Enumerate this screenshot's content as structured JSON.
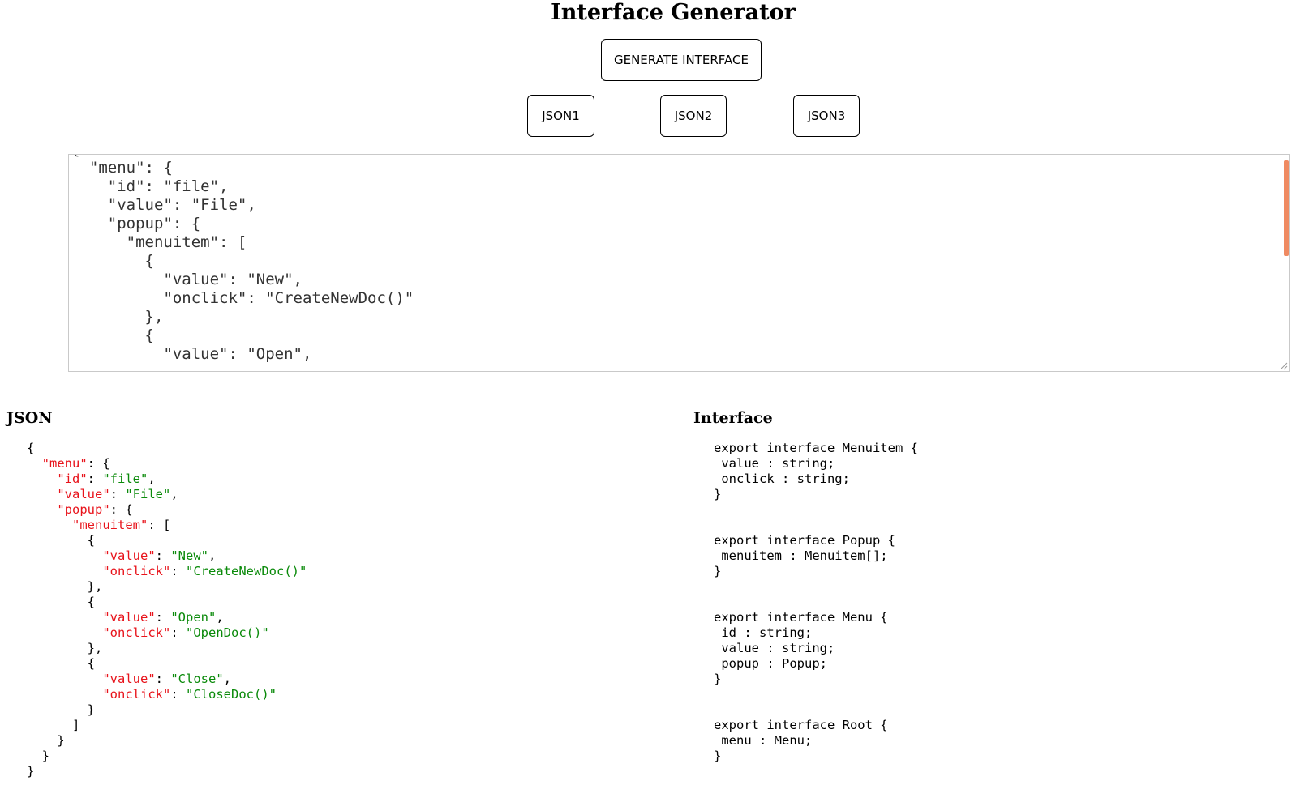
{
  "page": {
    "title": "Interface Generator"
  },
  "buttons": {
    "generate": "GENERATE INTERFACE",
    "json1": "JSON1",
    "json2": "JSON2",
    "json3": "JSON3"
  },
  "editor": {
    "visible_text": "{\n  \"menu\": {\n    \"id\": \"file\",\n    \"value\": \"File\",\n    \"popup\": {\n      \"menuitem\": [\n        {\n          \"value\": \"New\",\n          \"onclick\": \"CreateNewDoc()\"\n        },\n        {\n          \"value\": \"Open\","
  },
  "sections": {
    "json_heading": "JSON",
    "interface_heading": "Interface"
  },
  "json_view": {
    "lines": [
      [
        {
          "t": "p",
          "v": "{"
        }
      ],
      [
        {
          "t": "p",
          "v": "  "
        },
        {
          "t": "k",
          "v": "\"menu\""
        },
        {
          "t": "p",
          "v": ": {"
        }
      ],
      [
        {
          "t": "p",
          "v": "    "
        },
        {
          "t": "k",
          "v": "\"id\""
        },
        {
          "t": "p",
          "v": ": "
        },
        {
          "t": "s",
          "v": "\"file\""
        },
        {
          "t": "p",
          "v": ","
        }
      ],
      [
        {
          "t": "p",
          "v": "    "
        },
        {
          "t": "k",
          "v": "\"value\""
        },
        {
          "t": "p",
          "v": ": "
        },
        {
          "t": "s",
          "v": "\"File\""
        },
        {
          "t": "p",
          "v": ","
        }
      ],
      [
        {
          "t": "p",
          "v": "    "
        },
        {
          "t": "k",
          "v": "\"popup\""
        },
        {
          "t": "p",
          "v": ": {"
        }
      ],
      [
        {
          "t": "p",
          "v": "      "
        },
        {
          "t": "k",
          "v": "\"menuitem\""
        },
        {
          "t": "p",
          "v": ": ["
        }
      ],
      [
        {
          "t": "p",
          "v": "        {"
        }
      ],
      [
        {
          "t": "p",
          "v": "          "
        },
        {
          "t": "k",
          "v": "\"value\""
        },
        {
          "t": "p",
          "v": ": "
        },
        {
          "t": "s",
          "v": "\"New\""
        },
        {
          "t": "p",
          "v": ","
        }
      ],
      [
        {
          "t": "p",
          "v": "          "
        },
        {
          "t": "k",
          "v": "\"onclick\""
        },
        {
          "t": "p",
          "v": ": "
        },
        {
          "t": "s",
          "v": "\"CreateNewDoc()\""
        }
      ],
      [
        {
          "t": "p",
          "v": "        },"
        }
      ],
      [
        {
          "t": "p",
          "v": "        {"
        }
      ],
      [
        {
          "t": "p",
          "v": "          "
        },
        {
          "t": "k",
          "v": "\"value\""
        },
        {
          "t": "p",
          "v": ": "
        },
        {
          "t": "s",
          "v": "\"Open\""
        },
        {
          "t": "p",
          "v": ","
        }
      ],
      [
        {
          "t": "p",
          "v": "          "
        },
        {
          "t": "k",
          "v": "\"onclick\""
        },
        {
          "t": "p",
          "v": ": "
        },
        {
          "t": "s",
          "v": "\"OpenDoc()\""
        }
      ],
      [
        {
          "t": "p",
          "v": "        },"
        }
      ],
      [
        {
          "t": "p",
          "v": "        {"
        }
      ],
      [
        {
          "t": "p",
          "v": "          "
        },
        {
          "t": "k",
          "v": "\"value\""
        },
        {
          "t": "p",
          "v": ": "
        },
        {
          "t": "s",
          "v": "\"Close\""
        },
        {
          "t": "p",
          "v": ","
        }
      ],
      [
        {
          "t": "p",
          "v": "          "
        },
        {
          "t": "k",
          "v": "\"onclick\""
        },
        {
          "t": "p",
          "v": ": "
        },
        {
          "t": "s",
          "v": "\"CloseDoc()\""
        }
      ],
      [
        {
          "t": "p",
          "v": "        }"
        }
      ],
      [
        {
          "t": "p",
          "v": "      ]"
        }
      ],
      [
        {
          "t": "p",
          "v": "    }"
        }
      ],
      [
        {
          "t": "p",
          "v": "  }"
        }
      ],
      [
        {
          "t": "p",
          "v": "}"
        }
      ]
    ]
  },
  "interface_view": {
    "text": "export interface Menuitem {\n value : string;\n onclick : string;\n}\n\n\nexport interface Popup {\n menuitem : Menuitem[];\n}\n\n\nexport interface Menu {\n id : string;\n value : string;\n popup : Popup;\n}\n\n\nexport interface Root {\n menu : Menu;\n}"
  },
  "colors": {
    "json_key": "#e8131b",
    "json_string": "#0a8a0a",
    "scrollbar_thumb": "#ef8a62"
  }
}
